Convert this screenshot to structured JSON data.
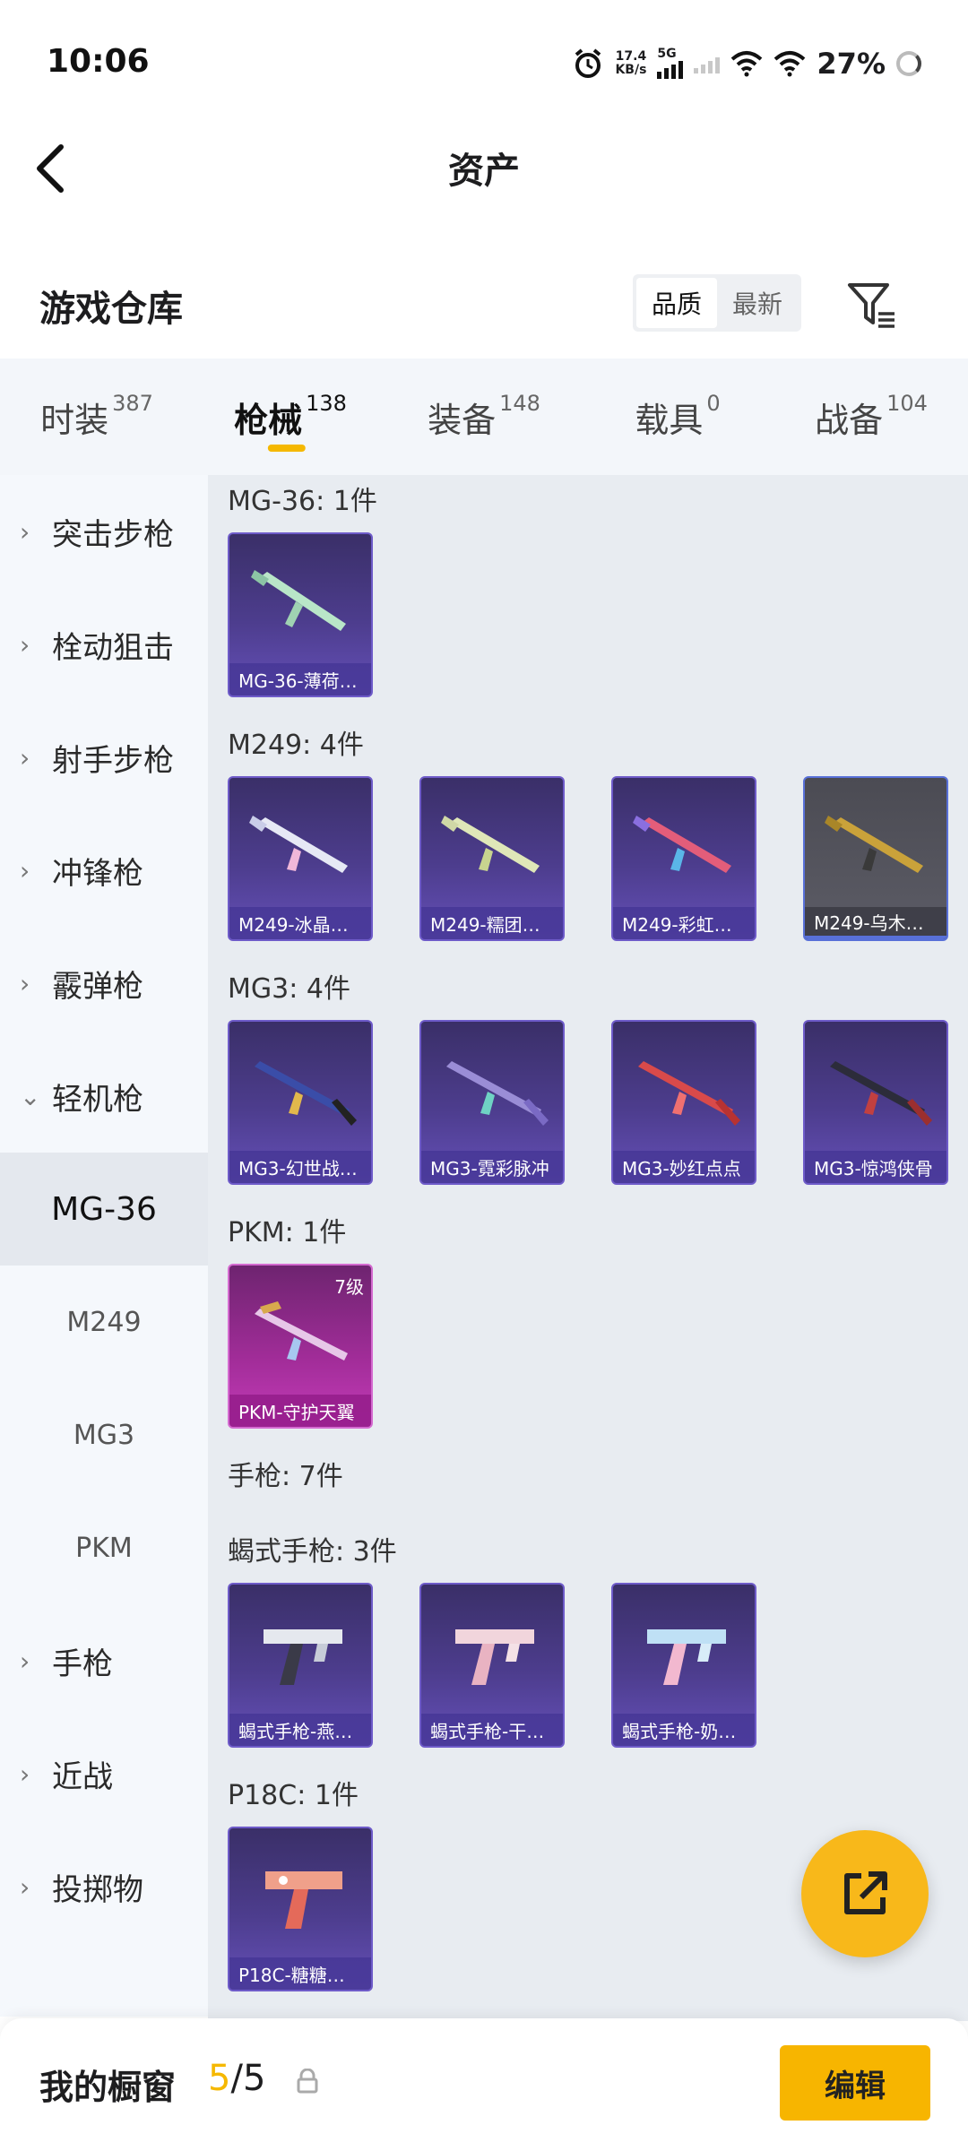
{
  "status_bar": {
    "time": "10:06",
    "net_speed_value": "17.4",
    "net_speed_unit": "KB/s",
    "network_type": "5G",
    "battery": "27%"
  },
  "header": {
    "title": "资产"
  },
  "warehouse": {
    "title": "游戏仓库",
    "sort_options": [
      "品质",
      "最新"
    ],
    "active_sort": "品质"
  },
  "tabs": [
    {
      "label": "时装",
      "count": "387"
    },
    {
      "label": "枪械",
      "count": "138",
      "active": true
    },
    {
      "label": "装备",
      "count": "148"
    },
    {
      "label": "载具",
      "count": "0"
    },
    {
      "label": "战备",
      "count": "104"
    }
  ],
  "sidebar": {
    "items": [
      {
        "label": "突击步枪",
        "chevron": "›"
      },
      {
        "label": "栓动狙击",
        "chevron": "›"
      },
      {
        "label": "射手步枪",
        "chevron": "›"
      },
      {
        "label": "冲锋枪",
        "chevron": "›"
      },
      {
        "label": "霰弹枪",
        "chevron": "›"
      },
      {
        "label": "轻机枪",
        "chevron": "⌄",
        "expanded": true
      }
    ],
    "sub_items": [
      {
        "label": "MG-36",
        "active": true
      },
      {
        "label": "M249"
      },
      {
        "label": "MG3"
      },
      {
        "label": "PKM"
      }
    ],
    "bottom_items": [
      {
        "label": "手枪",
        "chevron": "›"
      },
      {
        "label": "近战",
        "chevron": "›"
      },
      {
        "label": "投掷物",
        "chevron": "›"
      }
    ]
  },
  "sections": [
    {
      "title": "MG-36: 1件",
      "cards": [
        {
          "label": "MG-36-薄荷…",
          "style": "purple"
        }
      ]
    },
    {
      "title": "M249: 4件",
      "cards": [
        {
          "label": "M249-冰晶…",
          "style": "purple"
        },
        {
          "label": "M249-糯团…",
          "style": "purple"
        },
        {
          "label": "M249-彩虹…",
          "style": "purple"
        },
        {
          "label": "M249-乌木…",
          "style": "grey"
        }
      ]
    },
    {
      "title": "MG3: 4件",
      "cards": [
        {
          "label": "MG3-幻世战…",
          "style": "purple"
        },
        {
          "label": "MG3-霓彩脉冲",
          "style": "purple"
        },
        {
          "label": "MG3-妙红点点",
          "style": "purple"
        },
        {
          "label": "MG3-惊鸿侠骨",
          "style": "purple"
        }
      ]
    },
    {
      "title": "PKM: 1件",
      "cards": [
        {
          "label": "PKM-守护天翼",
          "style": "pink",
          "level": "7级"
        }
      ]
    },
    {
      "title": "手枪: 7件",
      "cards": []
    },
    {
      "title": "蝎式手枪: 3件",
      "cards": [
        {
          "label": "蝎式手枪-燕…",
          "style": "purple"
        },
        {
          "label": "蝎式手枪-干…",
          "style": "purple"
        },
        {
          "label": "蝎式手枪-奶…",
          "style": "purple"
        }
      ]
    },
    {
      "title": "P18C: 1件",
      "cards": [
        {
          "label": "P18C-糖糖…",
          "style": "purple"
        }
      ]
    }
  ],
  "bottom_bar": {
    "label": "我的橱窗",
    "count_current": "5",
    "count_separator": "/",
    "count_total": "5",
    "edit_label": "编辑"
  },
  "colors": {
    "accent": "#f5b800",
    "card_purple": "#4d3d8e",
    "card_pink": "#a32d9a",
    "card_grey": "#5c5c66"
  }
}
